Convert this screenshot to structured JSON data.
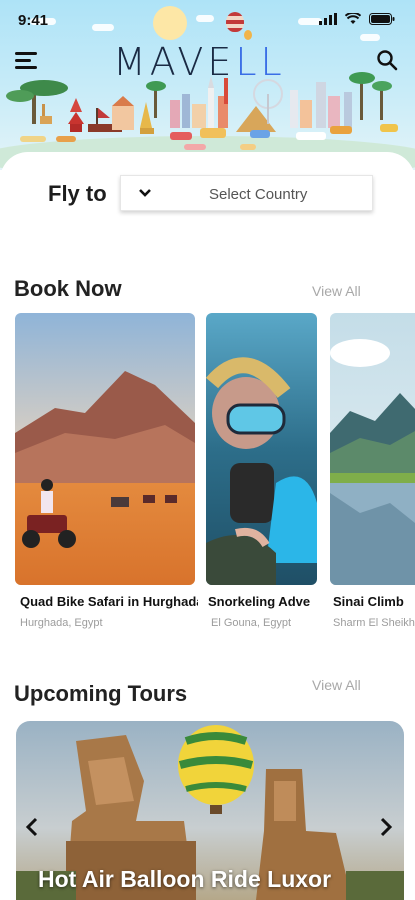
{
  "status_bar": {
    "time": "9:41"
  },
  "app": {
    "logo_main": "MAVE",
    "logo_accent": "LL"
  },
  "fly_to": {
    "label": "Fly to",
    "placeholder": "Select Country"
  },
  "book_now": {
    "title": "Book Now",
    "view_all": "View All",
    "items": [
      {
        "title": "Quad Bike Safari in Hurghada",
        "location": "Hurghada, Egypt"
      },
      {
        "title": "Snorkeling Adve",
        "location": "El Gouna, Egypt"
      },
      {
        "title": "Sinai Climb",
        "location": "Sharm El Sheikh"
      }
    ]
  },
  "upcoming_tours": {
    "title": "Upcoming Tours",
    "view_all": "View All",
    "featured": {
      "title": "Hot Air Balloon Ride Luxor"
    }
  },
  "colors": {
    "accent": "#3a6ee6",
    "sky": "#aee3f7",
    "text": "#1c1c1c",
    "muted": "#a8a8a8"
  },
  "icons": [
    "menu-icon",
    "search-icon",
    "chevron-down-icon",
    "chevron-left-icon",
    "chevron-right-icon",
    "signal-icon",
    "wifi-icon",
    "battery-icon"
  ]
}
